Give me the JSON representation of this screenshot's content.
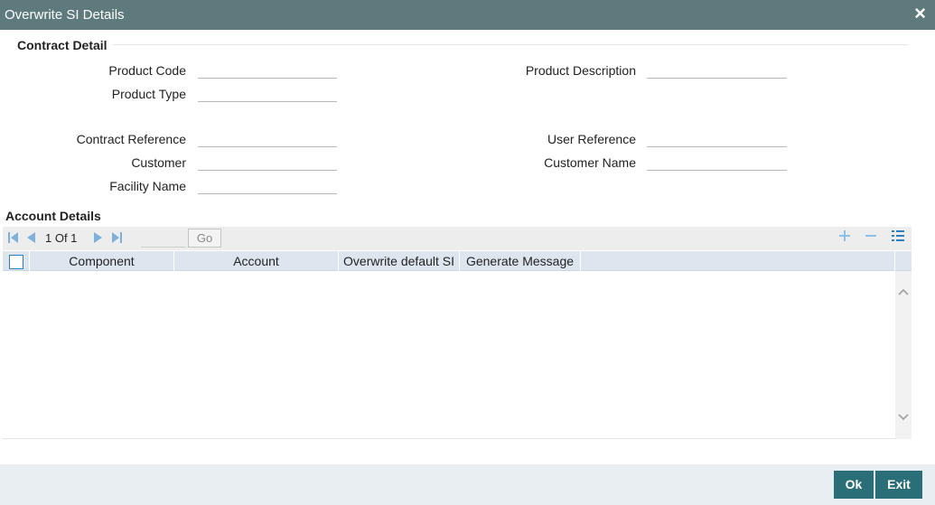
{
  "window": {
    "title": "Overwrite SI Details",
    "close_icon": "×"
  },
  "contract_detail": {
    "heading": "Contract Detail",
    "fields": {
      "product_code": {
        "label": "Product Code",
        "value": ""
      },
      "product_type": {
        "label": "Product Type",
        "value": ""
      },
      "product_description": {
        "label": "Product Description",
        "value": ""
      },
      "contract_reference": {
        "label": "Contract Reference",
        "value": ""
      },
      "customer": {
        "label": "Customer",
        "value": ""
      },
      "facility_name": {
        "label": "Facility Name",
        "value": ""
      },
      "user_reference": {
        "label": "User Reference",
        "value": ""
      },
      "customer_name": {
        "label": "Customer Name",
        "value": ""
      }
    }
  },
  "account_details": {
    "heading": "Account Details",
    "pager": {
      "text": "1 Of 1",
      "go_label": "Go",
      "page_input": ""
    },
    "icons": {
      "first": "first-page-icon",
      "prev": "prev-page-icon",
      "next": "next-page-icon",
      "last": "last-page-icon",
      "add": "add-row-icon",
      "delete": "delete-row-icon",
      "view": "single-view-icon"
    },
    "columns": [
      "Component",
      "Account",
      "Overwrite default SI",
      "Generate Message"
    ],
    "rows": []
  },
  "footer": {
    "ok_label": "Ok",
    "exit_label": "Exit"
  }
}
